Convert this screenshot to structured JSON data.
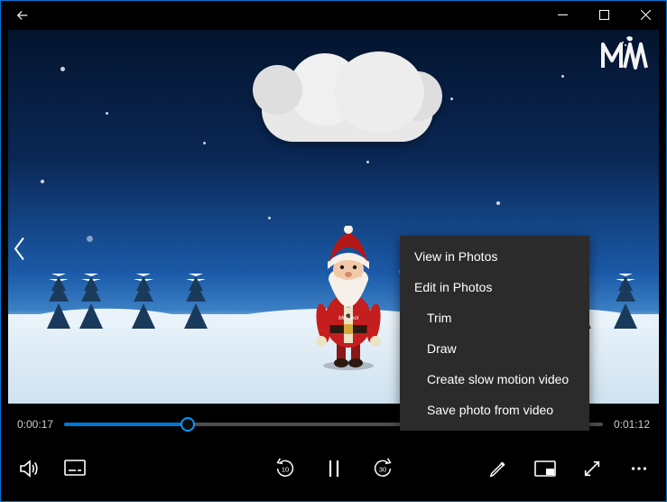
{
  "playback": {
    "current_time": "0:00:17",
    "total_time": "0:01:12",
    "progress_pct": 23
  },
  "skip": {
    "back_seconds": "10",
    "forward_seconds": "30"
  },
  "menu": {
    "view_in_photos": "View in Photos",
    "edit_in_photos": "Edit in Photos",
    "sub": {
      "trim": "Trim",
      "draw": "Draw",
      "slowmo": "Create slow motion video",
      "save_photo": "Save photo from video"
    }
  },
  "video_content": {
    "character_label": "MiniTool",
    "theme": "santa-winter-night"
  },
  "icons": {
    "back": "back-arrow",
    "minimize": "minimize",
    "maximize": "maximize",
    "close": "close",
    "prev": "chevron-left",
    "volume": "volume",
    "subtitles": "subtitles",
    "skip_back": "skip-back-10",
    "pause": "pause",
    "skip_fwd": "skip-fwd-30",
    "edit": "pencil",
    "mini": "mini-view",
    "fullscreen": "fullscreen",
    "more": "ellipsis"
  }
}
